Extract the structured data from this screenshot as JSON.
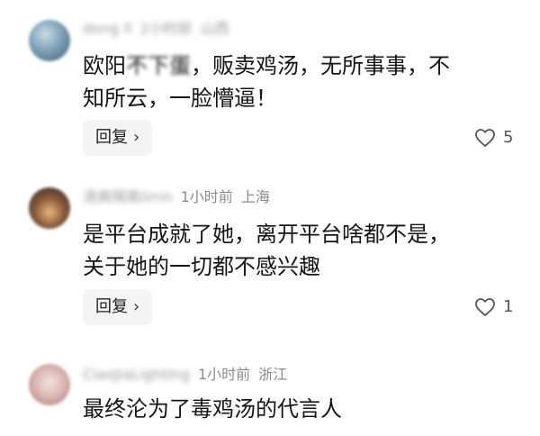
{
  "comments": [
    {
      "username": "dong ll",
      "time": "2小时前",
      "location": "山西",
      "text_lines": [
        {
          "pre": "欧阳",
          "blurred": "不下蛋",
          "post": "，贩卖鸡汤，无所事事，不"
        },
        {
          "pre": "知所云，一脸懵逼！",
          "blurred": "",
          "post": ""
        }
      ],
      "reply_label": "回复",
      "likes": "5"
    },
    {
      "username": "清爽隔离lirnn",
      "time": "1小时前",
      "location": "上海",
      "text_lines": [
        {
          "pre": "是平台成就了她，离开平台啥都不是，",
          "blurred": "",
          "post": ""
        },
        {
          "pre": "关于她的一切都不感兴趣",
          "blurred": "",
          "post": ""
        }
      ],
      "reply_label": "回复",
      "likes": "1"
    },
    {
      "username": "CiaoJiaLighting",
      "time": "1小时前",
      "location": "浙江",
      "text_lines": [
        {
          "pre": "最终沦为了毒鸡汤的代言人",
          "blurred": "",
          "post": ""
        }
      ]
    }
  ],
  "icons": {
    "like": "heart-outline-icon",
    "reply_chevron": "chevron-right-icon"
  },
  "colors": {
    "meta": "#8b8b8b",
    "reply_bg": "#f4f4f4",
    "text": "#141414"
  }
}
